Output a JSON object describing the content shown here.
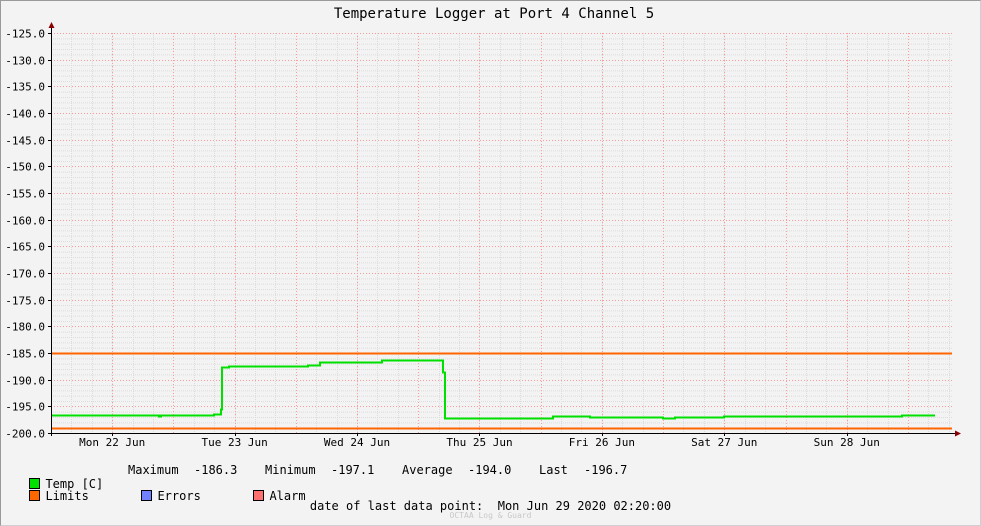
{
  "chart_data": {
    "type": "line",
    "title": "Temperature Logger at Port 4 Channel 5",
    "ylim": [
      -200,
      -125
    ],
    "y_ticks": [
      "-125.0",
      "-130.0",
      "-135.0",
      "-140.0",
      "-145.0",
      "-150.0",
      "-155.0",
      "-160.0",
      "-165.0",
      "-170.0",
      "-175.0",
      "-180.0",
      "-185.0",
      "-190.0",
      "-195.0",
      "-200.0"
    ],
    "x_ticks": [
      "Mon 22 Jun",
      "Tue 23 Jun",
      "Wed 24 Jun",
      "Thu 25 Jun",
      "Fri 26 Jun",
      "Sat 27 Jun",
      "Sun 28 Jun"
    ],
    "x_range_days": [
      0,
      7.36
    ],
    "grid": true,
    "series": [
      {
        "name": "Temp [C]",
        "color": "#00e000",
        "points": [
          [
            0.0,
            -196.7
          ],
          [
            0.88,
            -196.7
          ],
          [
            0.88,
            -196.8
          ],
          [
            0.9,
            -196.8
          ],
          [
            0.9,
            -196.7
          ],
          [
            1.33,
            -196.7
          ],
          [
            1.33,
            -196.5
          ],
          [
            1.39,
            -196.5
          ],
          [
            1.39,
            -195.5
          ],
          [
            1.4,
            -195.5
          ],
          [
            1.4,
            -187.7
          ],
          [
            1.45,
            -187.7
          ],
          [
            1.45,
            -187.5
          ],
          [
            1.9,
            -187.5
          ],
          [
            1.9,
            -187.4
          ],
          [
            2.0,
            -187.4
          ],
          [
            2.0,
            -187.5
          ],
          [
            2.1,
            -187.5
          ],
          [
            2.1,
            -187.3
          ],
          [
            2.2,
            -187.3
          ],
          [
            2.2,
            -186.6
          ],
          [
            2.7,
            -186.6
          ],
          [
            2.7,
            -186.4
          ],
          [
            3.2,
            -186.4
          ],
          [
            3.2,
            -188.6
          ],
          [
            3.22,
            -188.6
          ],
          [
            3.22,
            -197.1
          ],
          [
            4.1,
            -197.1
          ],
          [
            4.1,
            -196.9
          ],
          [
            4.4,
            -196.9
          ],
          [
            4.4,
            -197.0
          ],
          [
            5.0,
            -197.0
          ],
          [
            5.0,
            -197.1
          ],
          [
            5.1,
            -197.1
          ],
          [
            5.1,
            -197.0
          ],
          [
            5.5,
            -197.0
          ],
          [
            5.5,
            -196.8
          ],
          [
            6.9,
            -196.8
          ],
          [
            6.9,
            -196.9
          ],
          [
            6.95,
            -196.9
          ],
          [
            6.95,
            -196.7
          ],
          [
            7.22,
            -196.7
          ]
        ]
      },
      {
        "name": "Limits",
        "color": "#ff6600",
        "values": [
          -185.0,
          -199.0
        ]
      },
      {
        "name": "Errors",
        "color": "#7080ff"
      },
      {
        "name": "Alarm",
        "color": "#ff7070"
      }
    ]
  },
  "legend": {
    "temp_label": "Temp [C]",
    "max_label": "Maximum",
    "max_value": "-186.3",
    "min_label": "Minimum",
    "min_value": "-197.1",
    "avg_label": "Average",
    "avg_value": "-194.0",
    "last_label": "Last",
    "last_value": "-196.7",
    "limits_label": "Limits",
    "errors_label": "Errors",
    "alarm_label": "Alarm"
  },
  "footer": {
    "date_label": "date of last data point:",
    "date_value": "Mon Jun 29 2020 02:20:00",
    "watermark": "OCTAA Log & Guard"
  },
  "colors": {
    "temp": "#00e000",
    "limits": "#ff6600",
    "errors": "#7080ff",
    "alarm": "#ff7070",
    "grid_major": "#ff9a9a",
    "grid_minor": "#dcdcdc",
    "axis": "#000000",
    "arrow": "#8b0000"
  }
}
